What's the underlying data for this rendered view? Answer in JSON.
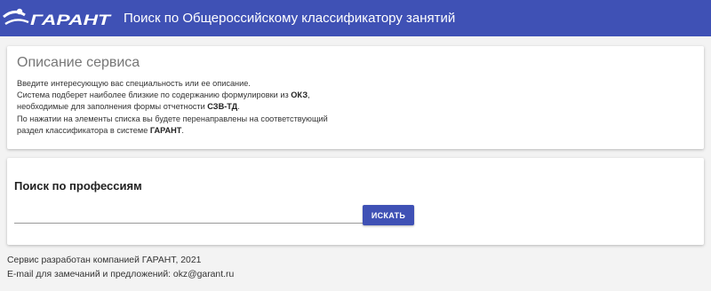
{
  "header": {
    "logo_text": "ГАРАНТ",
    "title": "Поиск по Общероссийскому классификатору занятий"
  },
  "description": {
    "title": "Описание сервиса",
    "line1": "Введите интересующую вас специальность или ее описание.",
    "line2_pre": "Система подберет наиболее близкие по содержанию формулировки из ",
    "line2_bold": "ОКЗ",
    "line2_post": ",",
    "line3_pre": "необходимые для заполнения формы отчетности ",
    "line3_bold": "СЗВ-ТД",
    "line3_post": ".",
    "line4": "По нажатии на элементы списка вы будете перенаправлены на соответствующий",
    "line5_pre": "раздел классификатора в системе ",
    "line5_bold": "ГАРАНТ",
    "line5_post": "."
  },
  "search": {
    "title": "Поиск по профессиям",
    "value": "",
    "button_label": "ИСКАТЬ"
  },
  "footer": {
    "line1": "Сервис разработан компанией ГАРАНТ, 2021",
    "line2": "E-mail для замечаний и предложений: okz@garant.ru"
  },
  "colors": {
    "header_bg": "#3f51b5",
    "button_bg": "#3f51b5",
    "page_bg": "#f3f3f3"
  }
}
